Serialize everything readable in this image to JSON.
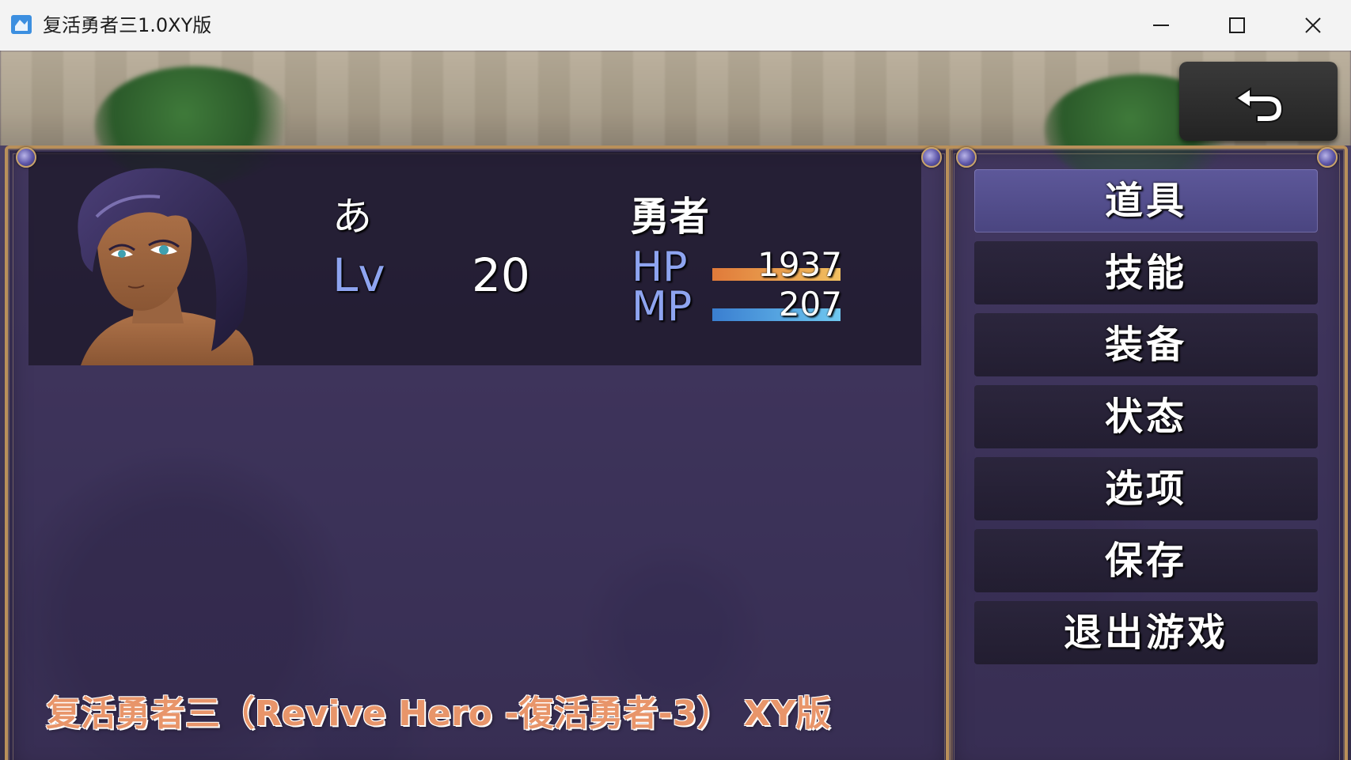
{
  "window": {
    "title": "复活勇者三1.0XY版",
    "app_icon": "app-icon",
    "controls": [
      "minimize-icon",
      "maximize-icon",
      "close-icon"
    ]
  },
  "back_button": {
    "icon": "return-arrow-icon"
  },
  "character": {
    "name": "あ",
    "class": "勇者",
    "level_label": "Lv",
    "level": "20",
    "hp_label": "HP",
    "hp": "1937",
    "hp_fill": 1.0,
    "mp_label": "MP",
    "mp": "207",
    "mp_fill": 1.0
  },
  "menu": {
    "selected_index": 0,
    "items": [
      {
        "label": "道具"
      },
      {
        "label": "技能"
      },
      {
        "label": "装备"
      },
      {
        "label": "状态"
      },
      {
        "label": "选项"
      },
      {
        "label": "保存"
      },
      {
        "label": "退出游戏"
      }
    ]
  },
  "watermark": "复活勇者三（Revive Hero -復活勇者-3） XY版",
  "colors": {
    "accent_blue_label": "#8ea4f0",
    "frame_gold": "#b9905a",
    "menu_selected": "#5d589a",
    "hp_gauge": "#e07a3a",
    "mp_gauge": "#3a7ed0",
    "watermark": "#e8956a"
  }
}
